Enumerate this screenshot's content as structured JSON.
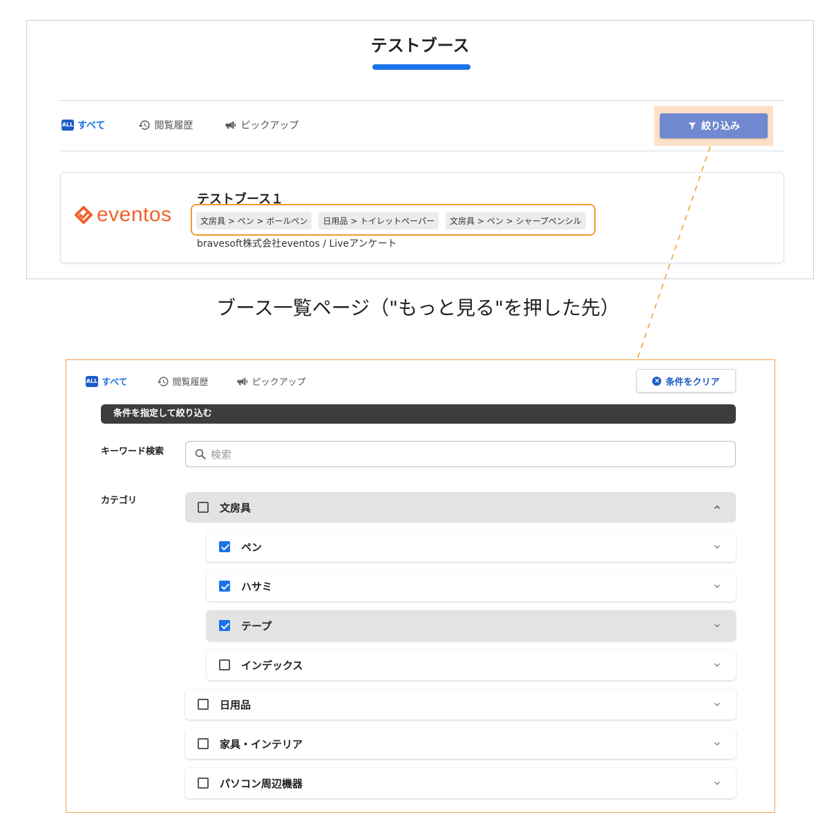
{
  "top": {
    "title": "テストブース",
    "tabs": [
      {
        "label": "すべて",
        "badge": "ALL",
        "icon": "all-badge-icon"
      },
      {
        "label": "閲覧履歴",
        "icon": "history-icon"
      },
      {
        "label": "ピックアップ",
        "icon": "megaphone-icon"
      }
    ],
    "filter_button": "絞り込み",
    "booth": {
      "logo_text": "eventos",
      "name": "テストブース１",
      "tags": [
        "文房具 > ペン > ボールペン",
        "日用品 > トイレットペーパー",
        "文房具 > ペン > シャープペンシル"
      ],
      "company": "bravesoft株式会社eventos / Liveアンケート"
    }
  },
  "caption": "ブース一覧ページ（\"もっと見る\"を押した先）",
  "filter": {
    "tabs": [
      {
        "label": "すべて",
        "badge": "ALL"
      },
      {
        "label": "閲覧履歴"
      },
      {
        "label": "ピックアップ"
      }
    ],
    "clear_button": "条件をクリア",
    "section_title": "条件を指定して絞り込む",
    "keyword_label": "キーワード検索",
    "search_placeholder": "検索",
    "category_label": "カテゴリ",
    "categories": [
      {
        "label": "文房具",
        "checked": false,
        "expanded": true
      },
      {
        "label": "ペン",
        "checked": true
      },
      {
        "label": "ハサミ",
        "checked": true
      },
      {
        "label": "テープ",
        "checked": true
      },
      {
        "label": "インデックス",
        "checked": false
      },
      {
        "label": "日用品",
        "checked": false
      },
      {
        "label": "家具・インテリア",
        "checked": false
      },
      {
        "label": "パソコン周辺機器",
        "checked": false
      }
    ]
  },
  "colors": {
    "accent": "#1a73e8",
    "filter_button": "#6f88cf",
    "highlight_orange": "#f39a2b",
    "logo_orange": "#f0622b"
  }
}
